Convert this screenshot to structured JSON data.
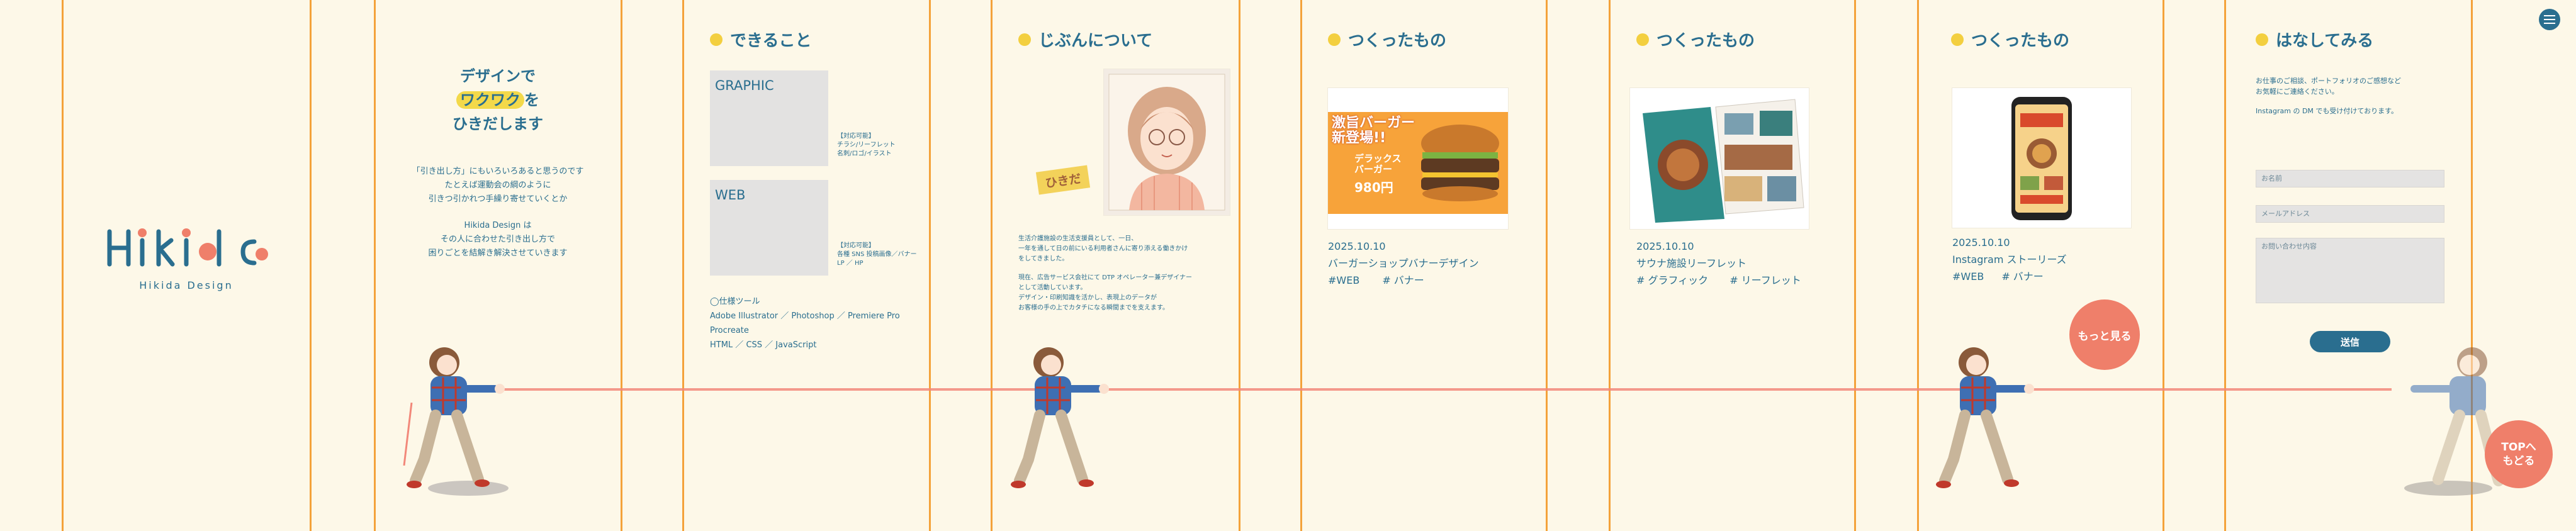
{
  "brand": {
    "logo_text": "Hikida",
    "tagline": "Hikida Design"
  },
  "menu": {
    "icon": "hamburger-menu-icon"
  },
  "intro": {
    "headline_1": "デザインで",
    "headline_2": "ワクワク",
    "headline_3": "を",
    "headline_4": "ひきだします",
    "para_1": "「引き出し方」にもいろいろあると思うのです",
    "para_2": "たとえば運動会の綱のように",
    "para_3": "引きつ引かれつ手繰り寄せていくとか",
    "para_4": "Hikida Design は",
    "para_5": "その人に合わせた引き出し方で",
    "para_6": "困りごとを結解き解決させていきます"
  },
  "skills": {
    "heading": "できること",
    "graphic_label": "GRAPHIC",
    "graphic_note_1": "【対応可能】",
    "graphic_note_2": "チラシ/リーフレット",
    "graphic_note_3": "名刺/ロゴ/イラスト",
    "web_label": "WEB",
    "web_note_1": "【対応可能】",
    "web_note_2": "各種 SNS 投稿画像／バナー",
    "web_note_3": "LP ／ HP",
    "tools_title": "◯仕様ツール",
    "tools_1": "Adobe Illustrator ／ Photoshop ／ Premiere Pro",
    "tools_2": "Procreate",
    "tools_3": "HTML ／ CSS ／ JavaScript"
  },
  "about": {
    "heading": "じぶんについて",
    "name_tag": "ひきだ",
    "bio_1": "生活介護施設の生活支援員として、一日、",
    "bio_2": "一年を通して日の前にいる利用者さんに寄り添える働きかけ",
    "bio_3": "をしてきました。",
    "bio_4": "現在、広告サービス会社にて DTP オペレーター兼デザイナー",
    "bio_5": "として活動しています。",
    "bio_6": "デザイン・印刷知識を活かし、表現上のデータが",
    "bio_7": "お客様の手の上でカタチになる瞬間までを支えます。"
  },
  "works": [
    {
      "heading": "つくったもの",
      "date": "2025.10.10",
      "title": "バーガーショップバナーデザイン",
      "tag_1": "#WEB",
      "tag_2": "# バナー",
      "banner_1": "激旨バーガー",
      "banner_2": "新登場!!",
      "banner_3": "デラックス",
      "banner_4": "バーガー",
      "banner_price": "980円"
    },
    {
      "heading": "つくったもの",
      "date": "2025.10.10",
      "title": "サウナ施設リーフレット",
      "tag_1": "# グラフィック",
      "tag_2": "# リーフレット"
    },
    {
      "heading": "つくったもの",
      "date": "2025.10.10",
      "title": "Instagram ストーリーズ",
      "tag_1": "#WEB",
      "tag_2": "# バナー"
    }
  ],
  "more_button": "もっと見る",
  "contact": {
    "heading": "はなしてみる",
    "text_1": "お仕事のご相談、ポートフォリオのご感想など",
    "text_2": "お気軽にご連絡ください。",
    "text_3": "Instagram の DM でも受け付けております。",
    "name_placeholder": "お名前",
    "email_placeholder": "メールアドレス",
    "message_placeholder": "お問い合わせ内容",
    "submit_label": "送信"
  },
  "top_button": {
    "line_1": "TOPへ",
    "line_2": "もどる"
  },
  "colors": {
    "background": "#fdf8e8",
    "line": "#f4a23a",
    "text": "#2a6e8f",
    "accent_dot": "#f3cf3f",
    "coral": "#ef7f6a",
    "submit": "#2a6e8f"
  }
}
